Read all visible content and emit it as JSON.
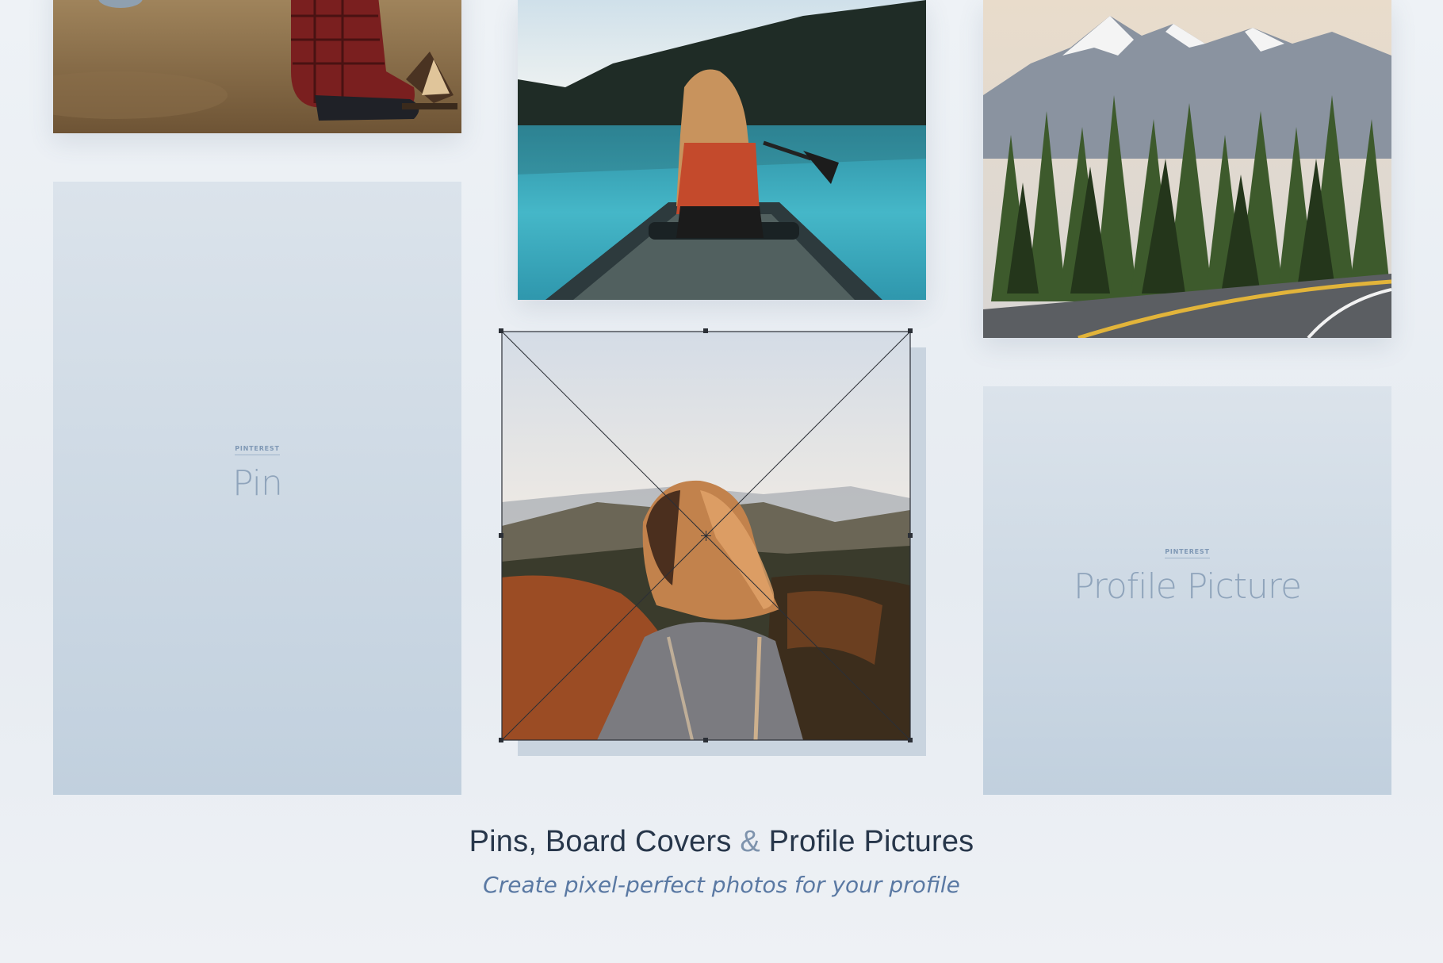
{
  "panels": {
    "pin": {
      "kicker": "PINTEREST",
      "title": "Pin"
    },
    "profile": {
      "kicker": "PINTEREST",
      "title": "Profile Picture"
    }
  },
  "caption": {
    "title_part1": "Pins, Board Covers",
    "ampersand": "&",
    "title_part2": "Profile Pictures",
    "subtitle": "Create pixel-perfect photos for your profile"
  },
  "colors": {
    "background": "#eef2f6",
    "panel_top": "#dbe3eb",
    "panel_bottom": "#c1d0de",
    "title": "#27364a",
    "subtitle": "#5a79a3",
    "kicker": "#7f98b5"
  }
}
